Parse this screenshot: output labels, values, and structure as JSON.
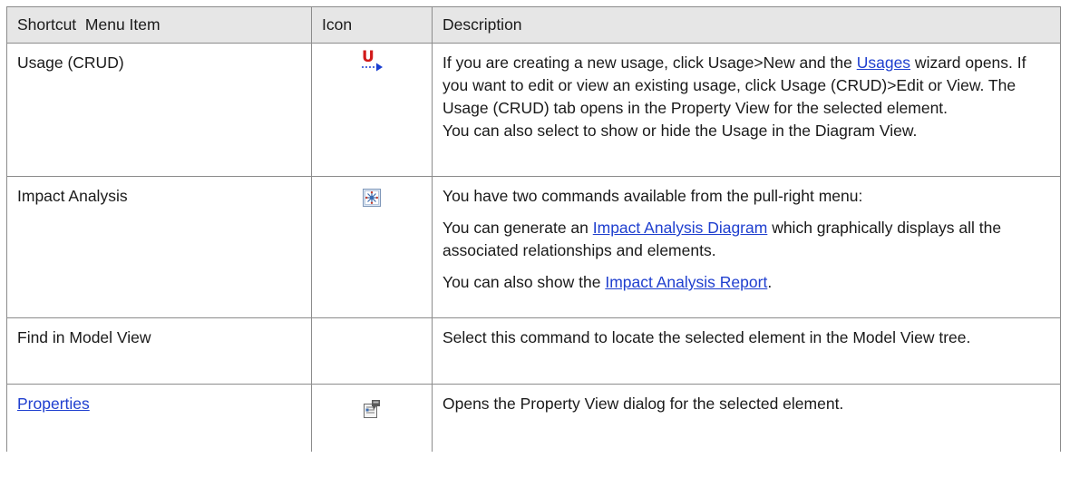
{
  "headers": {
    "col1": "Shortcut  Menu Item",
    "col2": "Icon",
    "col3": "Description"
  },
  "rows": [
    {
      "item": "Usage (CRUD)",
      "icon": "usage-crud-icon",
      "desc_p1_before": "If you are creating a new usage, click Usage>New and the ",
      "desc_p1_link": "Usages",
      "desc_p1_after": " wizard opens. If you want to edit or view an existing usage, click Usage (CRUD)>Edit or View. The Usage (CRUD) tab opens in the Property View for the selected element.",
      "desc_p2": "You can also select to show or hide the Usage in the Diagram View."
    },
    {
      "item": "Impact Analysis",
      "icon": "impact-analysis-icon",
      "desc_p1": "You have two commands available from the pull-right menu:",
      "desc_p2_before": "You can generate an ",
      "desc_p2_link": "Impact Analysis Diagram",
      "desc_p2_after": " which graphically displays all the associated relationships and elements.",
      "desc_p3_before": "You can also show the ",
      "desc_p3_link": "Impact Analysis Report",
      "desc_p3_after": "."
    },
    {
      "item": "Find in Model View",
      "icon": "",
      "desc": "Select this command to locate the selected element in the Model View tree."
    },
    {
      "item": "Properties",
      "icon": "properties-icon",
      "desc": "Opens the Property View dialog for the selected element."
    }
  ],
  "colors": {
    "link": "#1f3fcf",
    "header_bg": "#e6e6e6",
    "border": "#8c8c8c",
    "usage_icon_red": "#d11a1a",
    "usage_icon_blue": "#1a3fd1"
  }
}
